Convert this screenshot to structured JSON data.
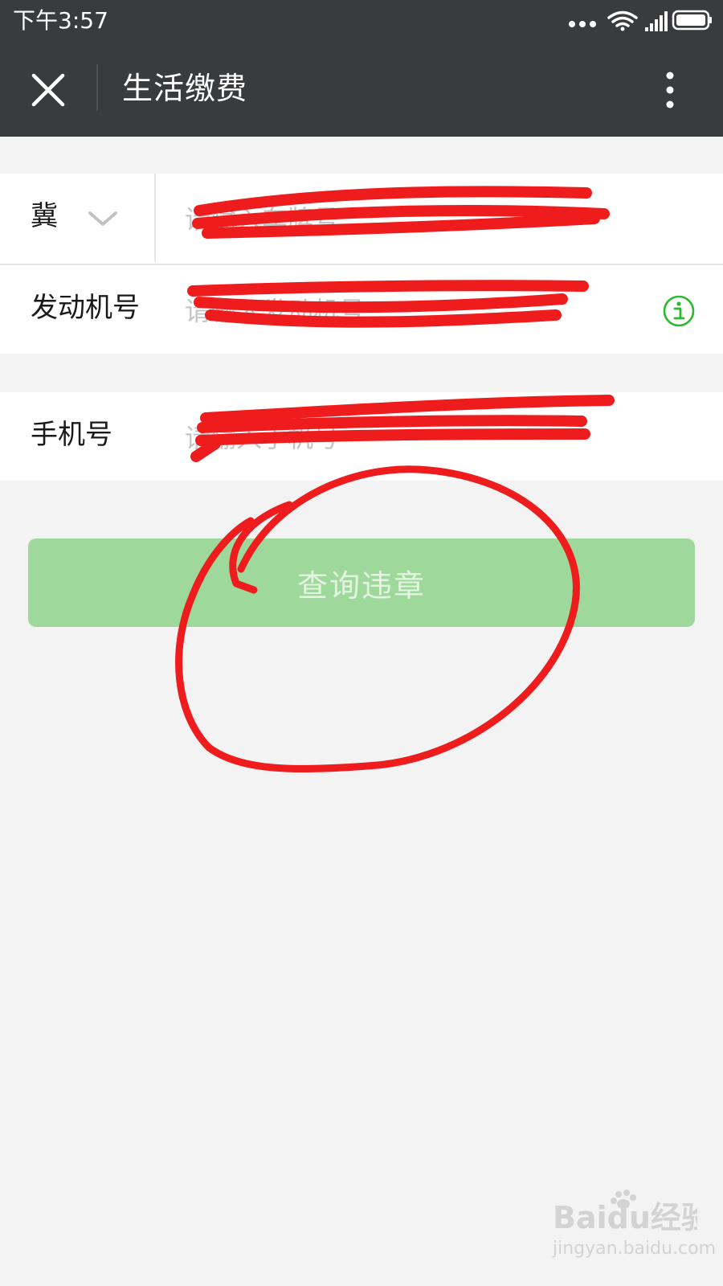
{
  "status_bar": {
    "time": "下午3:57"
  },
  "nav": {
    "title": "生活缴费"
  },
  "form": {
    "province": {
      "value": "冀"
    },
    "plate": {
      "placeholder": "请输入车牌号"
    },
    "engine": {
      "label": "发动机号",
      "placeholder": "请输入发动机号"
    },
    "phone": {
      "label": "手机号",
      "placeholder": "请输入手机号"
    }
  },
  "query_button": {
    "label": "查询违章"
  },
  "watermark": {
    "logo_text": "Baidu经验",
    "url": "jingyan.baidu.com"
  },
  "colors": {
    "header_bg": "#3a3b3f",
    "page_bg": "#f4f3f4",
    "button_bg": "#9ed89b",
    "button_text": "#e3f4e1",
    "info_green": "#2eb82e",
    "annotation_red": "#ee1c1c"
  },
  "icons": {
    "close": "close-icon",
    "more": "more-vertical-icon",
    "dropdown": "chevron-down-icon",
    "info": "info-icon",
    "wifi": "wifi-icon",
    "signal": "signal-icon",
    "battery": "battery-icon"
  }
}
